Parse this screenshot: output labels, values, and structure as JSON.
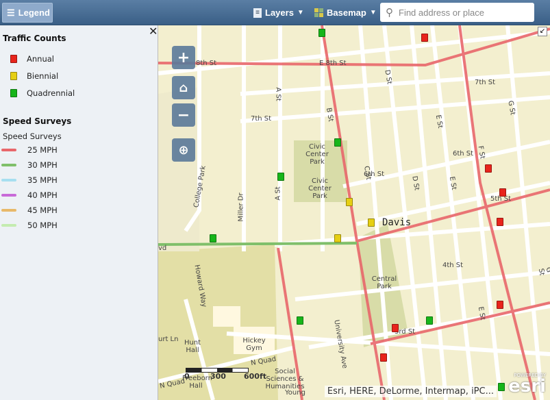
{
  "header": {
    "legend_label": "Legend",
    "layers_label": "Layers",
    "basemap_label": "Basemap",
    "search_placeholder": "Find address or place"
  },
  "legend": {
    "traffic_title": "Traffic Counts",
    "traffic_items": [
      {
        "label": "Annual",
        "color": "#e8241c"
      },
      {
        "label": "Biennial",
        "color": "#e6cf14"
      },
      {
        "label": "Quadrennial",
        "color": "#17b51a"
      }
    ],
    "speed_title": "Speed Surveys",
    "speed_sublabel": "Speed Surveys",
    "speed_items": [
      {
        "label": "25 MPH",
        "color": "#e8676b"
      },
      {
        "label": "30 MPH",
        "color": "#7fbf6a"
      },
      {
        "label": "35 MPH",
        "color": "#a7dff0"
      },
      {
        "label": "40 MPH",
        "color": "#c86ad8"
      },
      {
        "label": "45 MPH",
        "color": "#e8b96a"
      },
      {
        "label": "50 MPH",
        "color": "#c4ecb0"
      }
    ]
  },
  "map": {
    "labels": {
      "e8th": "E 8th St",
      "th8": "8th St",
      "d_st_top": "D St",
      "st7e": "7th St",
      "st7w": "7th St",
      "a_st_top": "A St",
      "b_st": "B St",
      "c_st": "C St",
      "d_st": "D St",
      "e_st": "E St",
      "f_st": "F St",
      "g_st": "G St",
      "e_st2": "E St",
      "st6": "6th St",
      "st6e": "6th St",
      "st5": "5th St",
      "st4": "4th St",
      "st3": "3rd St",
      "a_st": "A St",
      "miller": "Miller Dr",
      "college": "College Park",
      "college2": "College Park",
      "howard": "Howard Way",
      "univ": "University Ave",
      "civic1": "Civic Center Park",
      "civic2": "Civic Center Park",
      "central": "Central Park",
      "davis": "Davis",
      "hunt": "Hunt Hall",
      "hickey": "Hickey Gym",
      "nquad": "N Quad",
      "nquad2": "N Quad",
      "social": "Social Sciences & Humanities",
      "freeborn": "Freeborn Hall",
      "young": "Young",
      "curt": "urt Ln",
      "vd": "vd",
      "e_st3": "E St",
      "g_st2": "G St"
    },
    "scale": {
      "t0": "0",
      "t1": "300",
      "t2": "600ft"
    },
    "attribution": "Esri, HERE, DeLorme, Intermap, iPC...",
    "esri_logo": "POWERED BY esri"
  }
}
